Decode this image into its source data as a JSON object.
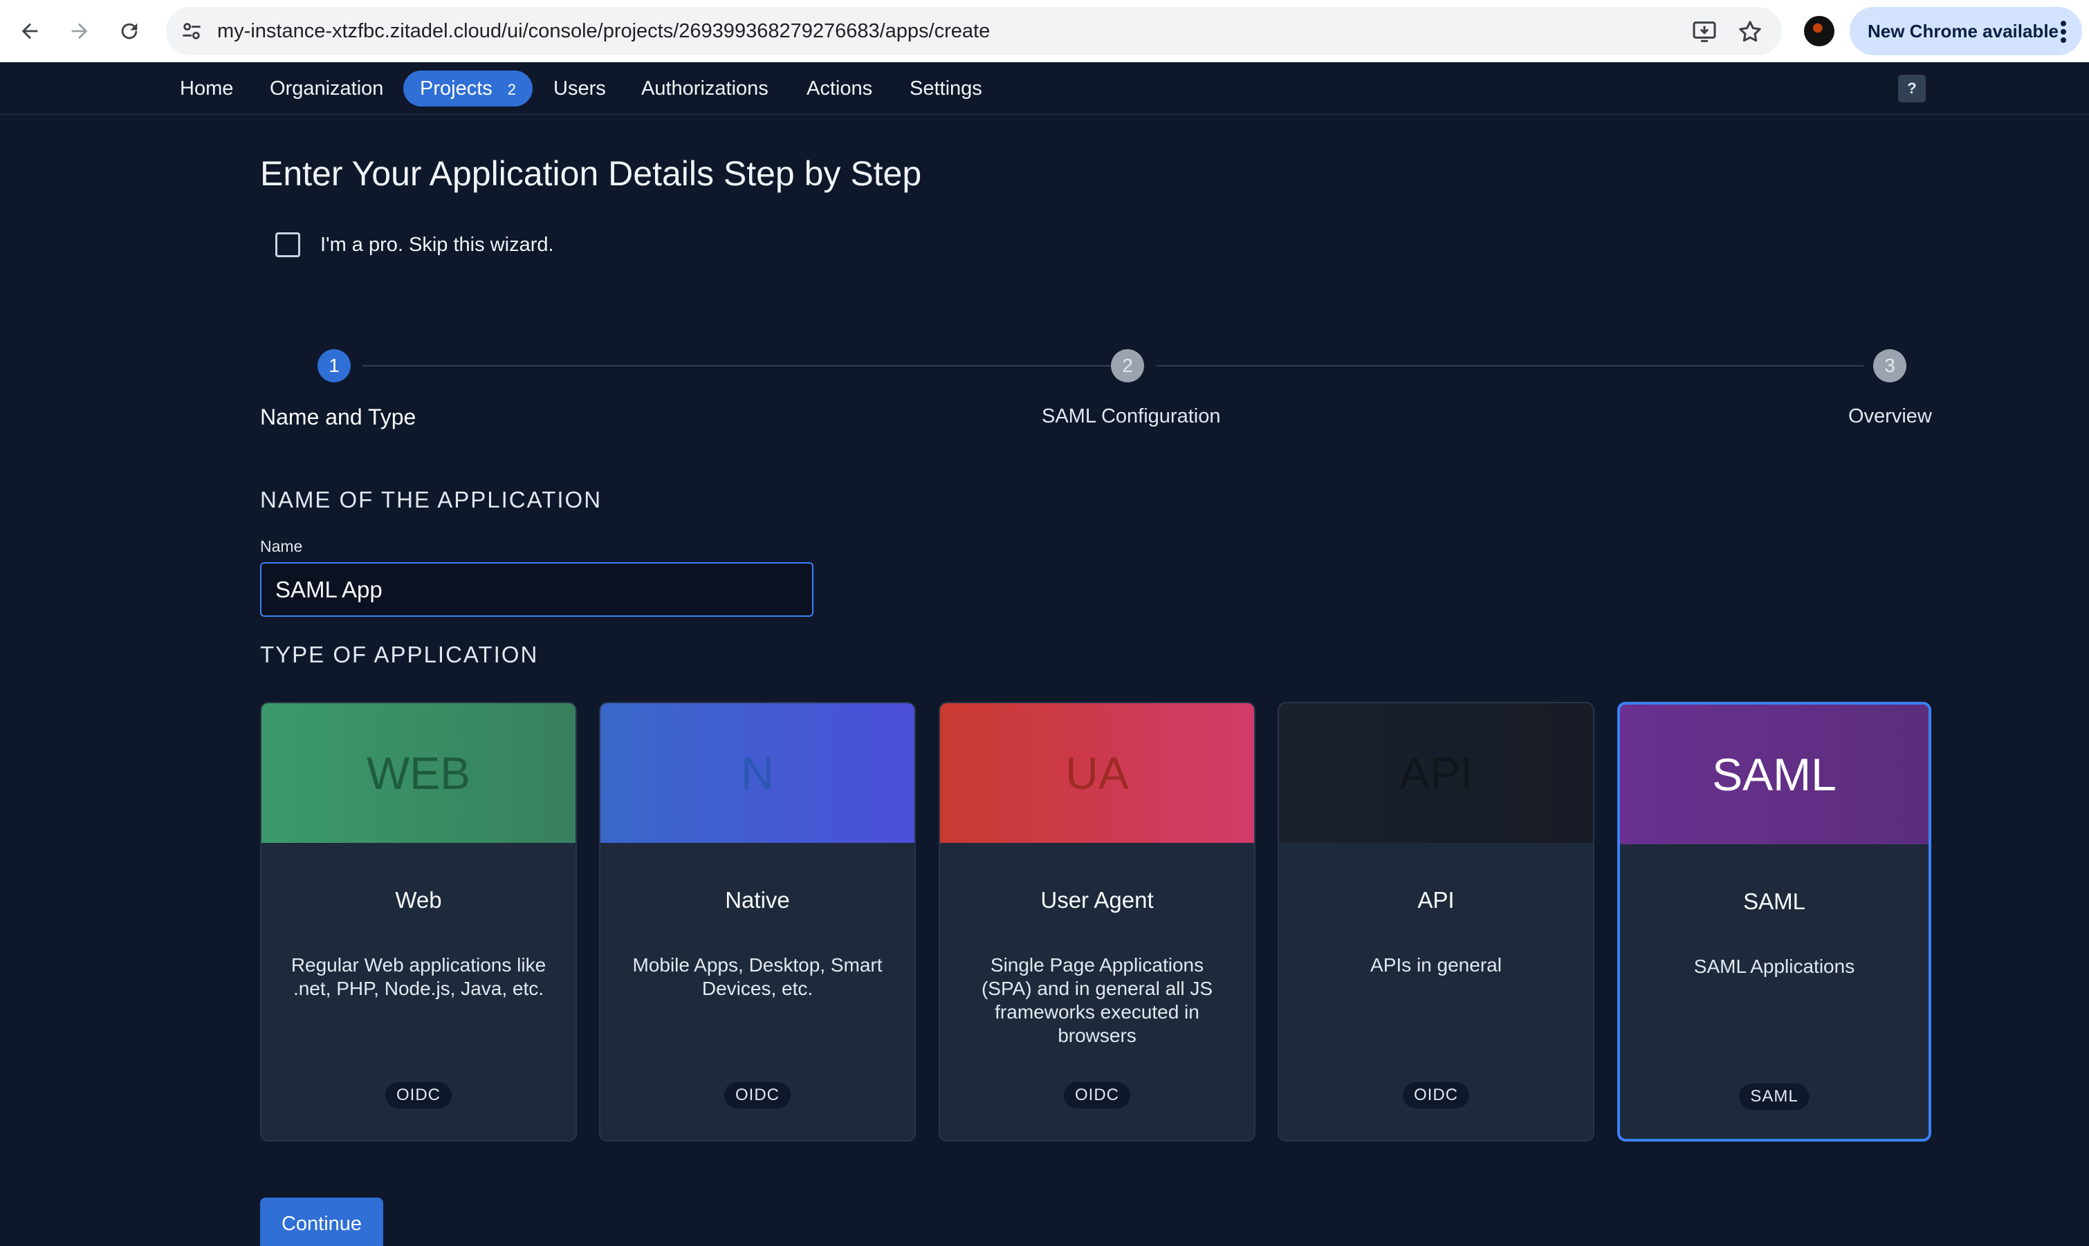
{
  "browser": {
    "url": "my-instance-xtzfbc.zitadel.cloud/ui/console/projects/269399368279276683/apps/create",
    "update_label": "New Chrome available"
  },
  "nav": {
    "items": [
      {
        "label": "Home"
      },
      {
        "label": "Organization"
      },
      {
        "label": "Projects",
        "count": "2"
      },
      {
        "label": "Users"
      },
      {
        "label": "Authorizations"
      },
      {
        "label": "Actions"
      },
      {
        "label": "Settings"
      }
    ],
    "help_label": "?"
  },
  "page": {
    "title": "Enter Your Application Details Step by Step",
    "skip_label": "I'm a pro. Skip this wizard.",
    "skip_checked": false
  },
  "steps": [
    {
      "number": "1",
      "label": "Name and Type",
      "active": true
    },
    {
      "number": "2",
      "label": "SAML Configuration",
      "active": false
    },
    {
      "number": "3",
      "label": "Overview",
      "active": false
    }
  ],
  "name_section": {
    "heading": "NAME OF THE APPLICATION",
    "field_label": "Name",
    "value": "SAML App"
  },
  "type_section": {
    "heading": "TYPE OF APPLICATION",
    "cards": [
      {
        "banner": "WEB",
        "title": "Web",
        "description": "Regular Web applications like .net, PHP, Node.js, Java, etc.",
        "badge": "OIDC",
        "selected": false
      },
      {
        "banner": "N",
        "title": "Native",
        "description": "Mobile Apps, Desktop, Smart Devices, etc.",
        "badge": "OIDC",
        "selected": false
      },
      {
        "banner": "UA",
        "title": "User Agent",
        "description": "Single Page Applications (SPA) and in general all JS frameworks executed in browsers",
        "badge": "OIDC",
        "selected": false
      },
      {
        "banner": "API",
        "title": "API",
        "description": "APIs in general",
        "badge": "OIDC",
        "selected": false
      },
      {
        "banner": "SAML",
        "title": "SAML",
        "description": "SAML Applications",
        "badge": "SAML",
        "selected": true
      }
    ]
  },
  "actions": {
    "continue_label": "Continue"
  },
  "colors": {
    "background": "#0f172a",
    "accent": "#2f6fd6",
    "card": "#1e293b"
  }
}
